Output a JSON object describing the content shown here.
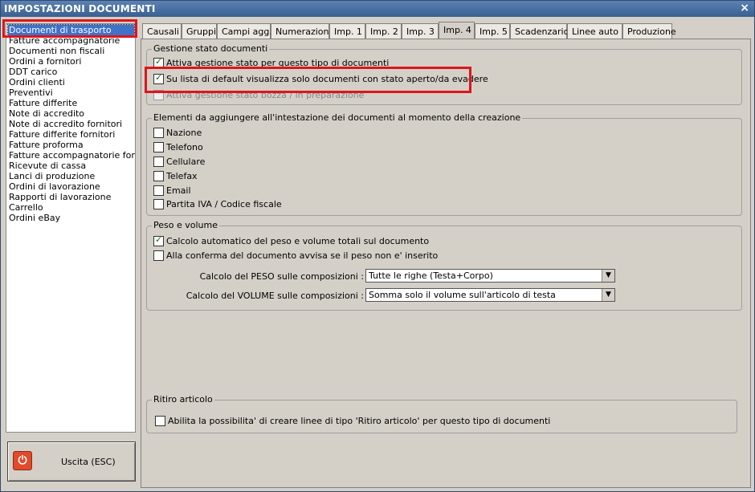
{
  "window": {
    "title": "IMPOSTAZIONI DOCUMENTI",
    "close_glyph": "×"
  },
  "left_list": {
    "items": [
      "Documenti di trasporto",
      "Fatture accompagnatorie",
      "Documenti non fiscali",
      "Ordini a fornitori",
      "DDT carico",
      "Ordini clienti",
      "Preventivi",
      "Fatture differite",
      "Note di accredito",
      "Note di accredito fornitori",
      "Fatture differite fornitori",
      "Fatture proforma",
      "Fatture accompagnatorie fornito",
      "Ricevute di cassa",
      "Lanci di produzione",
      "Ordini di lavorazione",
      "Rapporti di lavorazione",
      "Carrello",
      "Ordini eBay"
    ],
    "selected_index": 0
  },
  "exit_button": {
    "label": "Uscita (ESC)",
    "icon": "power-icon"
  },
  "tabs": [
    "Causali",
    "Gruppi",
    "Campi agg.",
    "Numerazioni",
    "Imp. 1",
    "Imp. 2",
    "Imp. 3",
    "Imp. 4",
    "Imp. 5",
    "Scadenzario",
    "Linee auto",
    "Produzione"
  ],
  "active_tab_index": 7,
  "gestione_stato": {
    "legend": "Gestione stato documenti",
    "items": [
      {
        "label": "Attiva gestione stato per questo tipo di documenti",
        "checked": true,
        "disabled": false
      },
      {
        "label": "Su lista di default visualizza solo documenti con stato aperto/da evadere",
        "checked": true,
        "disabled": false
      },
      {
        "label": "Attiva gestione stato bozza / in preparazione",
        "checked": false,
        "disabled": true
      }
    ]
  },
  "elementi": {
    "legend": "Elementi da aggiungere all'intestazione dei documenti al momento della creazione",
    "items": [
      {
        "label": "Nazione",
        "checked": false
      },
      {
        "label": "Telefono",
        "checked": false
      },
      {
        "label": "Cellulare",
        "checked": false
      },
      {
        "label": "Telefax",
        "checked": false
      },
      {
        "label": "Email",
        "checked": false
      },
      {
        "label": "Partita IVA / Codice fiscale",
        "checked": false
      }
    ]
  },
  "peso_volume": {
    "legend": "Peso e volume",
    "items": [
      {
        "label": "Calcolo automatico del peso e volume totali sul documento",
        "checked": true
      },
      {
        "label": "Alla conferma del documento avvisa se il peso non e' inserito",
        "checked": false
      }
    ],
    "peso_label": "Calcolo del PESO sulle composizioni :",
    "peso_value": "Tutte le righe (Testa+Corpo)",
    "volume_label": "Calcolo del VOLUME sulle composizioni :",
    "volume_value": "Somma solo il volume sull'articolo di testa"
  },
  "ritiro": {
    "legend": "Ritiro articolo",
    "items": [
      {
        "label": "Abilita la possibilita' di creare linee di tipo 'Ritiro articolo' per questo tipo di documenti",
        "checked": false
      }
    ]
  },
  "colors": {
    "highlight_box": "#e0141a",
    "selection": "#3f72c9",
    "window_bg": "#d4d0c8",
    "titlebar": "#4a6fa0"
  }
}
